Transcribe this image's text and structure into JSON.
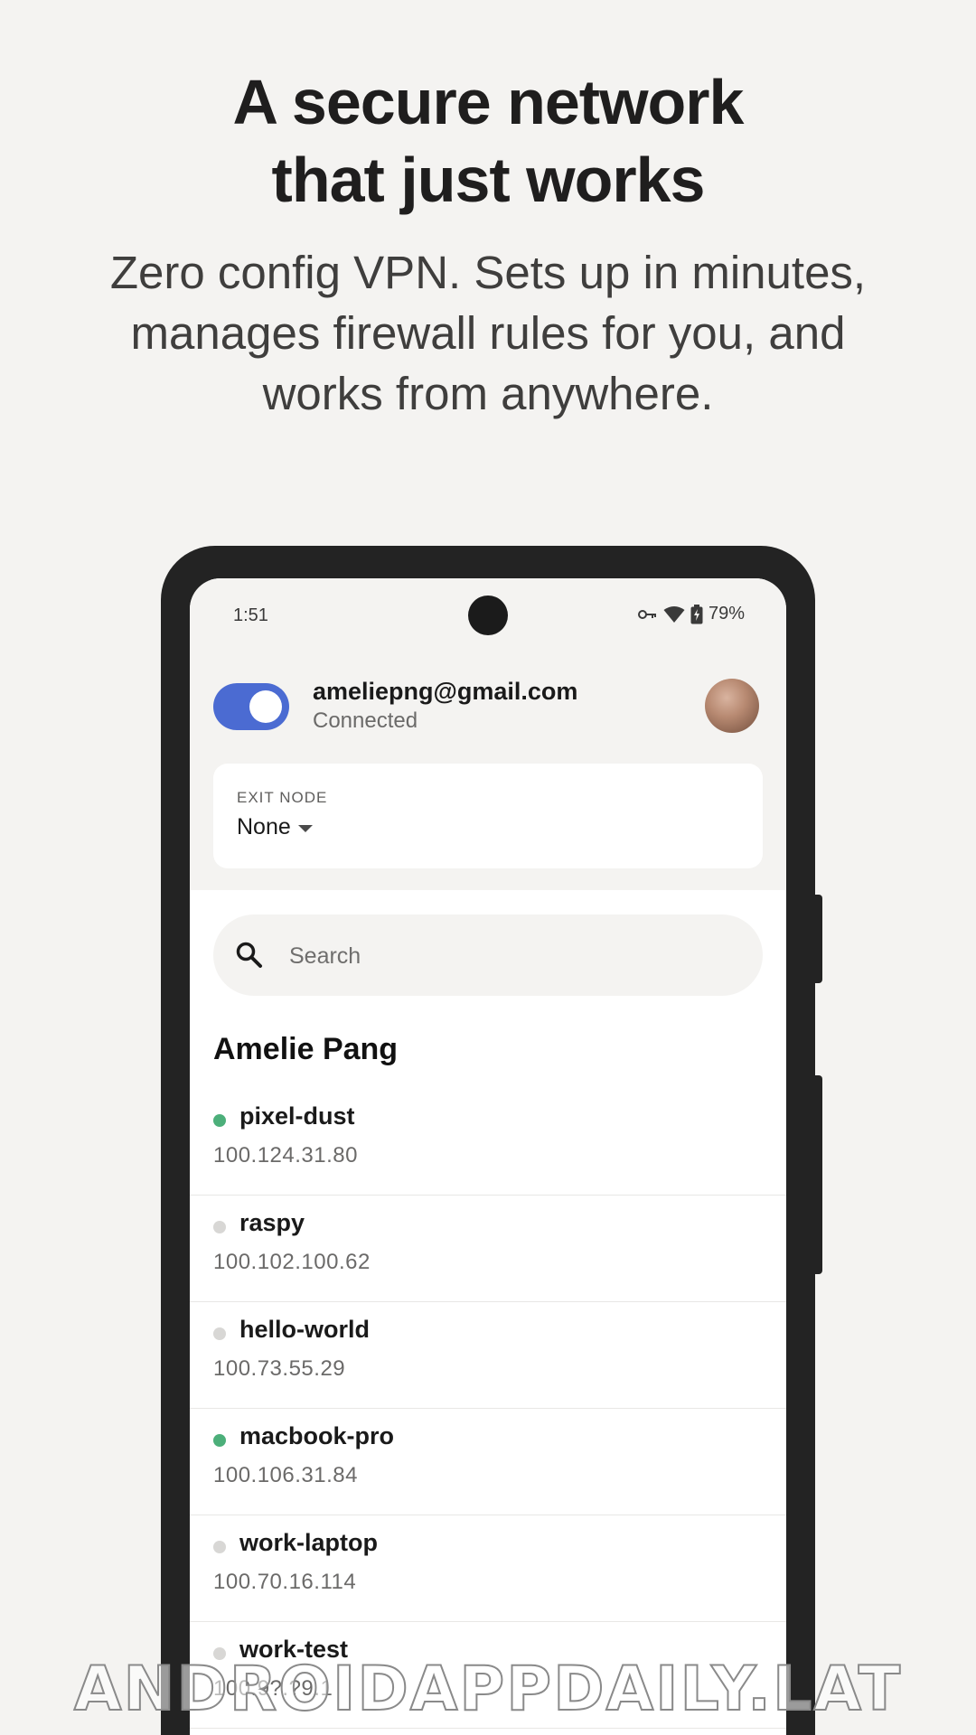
{
  "promo": {
    "headline_line1": "A secure network",
    "headline_line2": "that just works",
    "sub_line1": "Zero config VPN. Sets up in minutes,",
    "sub_line2": "manages firewall rules for you, and",
    "sub_line3": "works from anywhere."
  },
  "status_bar": {
    "time": "1:51",
    "battery": "79%",
    "icons": [
      "vpn-key-icon",
      "wifi-icon",
      "battery-charging-icon"
    ]
  },
  "account": {
    "email": "ameliepng@gmail.com",
    "status": "Connected",
    "vpn_enabled": true,
    "toggle_color": "#4b6bd2"
  },
  "exit_node": {
    "label": "EXIT NODE",
    "value": "None"
  },
  "search": {
    "placeholder": "Search"
  },
  "owner": {
    "name": "Amelie Pang"
  },
  "devices": [
    {
      "name": "pixel-dust",
      "ip": "100.124.31.80",
      "online": true
    },
    {
      "name": "raspy",
      "ip": "100.102.100.62",
      "online": false
    },
    {
      "name": "hello-world",
      "ip": "100.73.55.29",
      "online": false
    },
    {
      "name": "macbook-pro",
      "ip": "100.106.31.84",
      "online": true
    },
    {
      "name": "work-laptop",
      "ip": "100.70.16.114",
      "online": false
    },
    {
      "name": "work-test",
      "ip": "100.9?.?9.1",
      "online": false
    }
  ],
  "colors": {
    "online": "#4caf7a",
    "offline": "#d8d7d5"
  },
  "watermark": "ANDROIDAPPDAILY.LAT"
}
